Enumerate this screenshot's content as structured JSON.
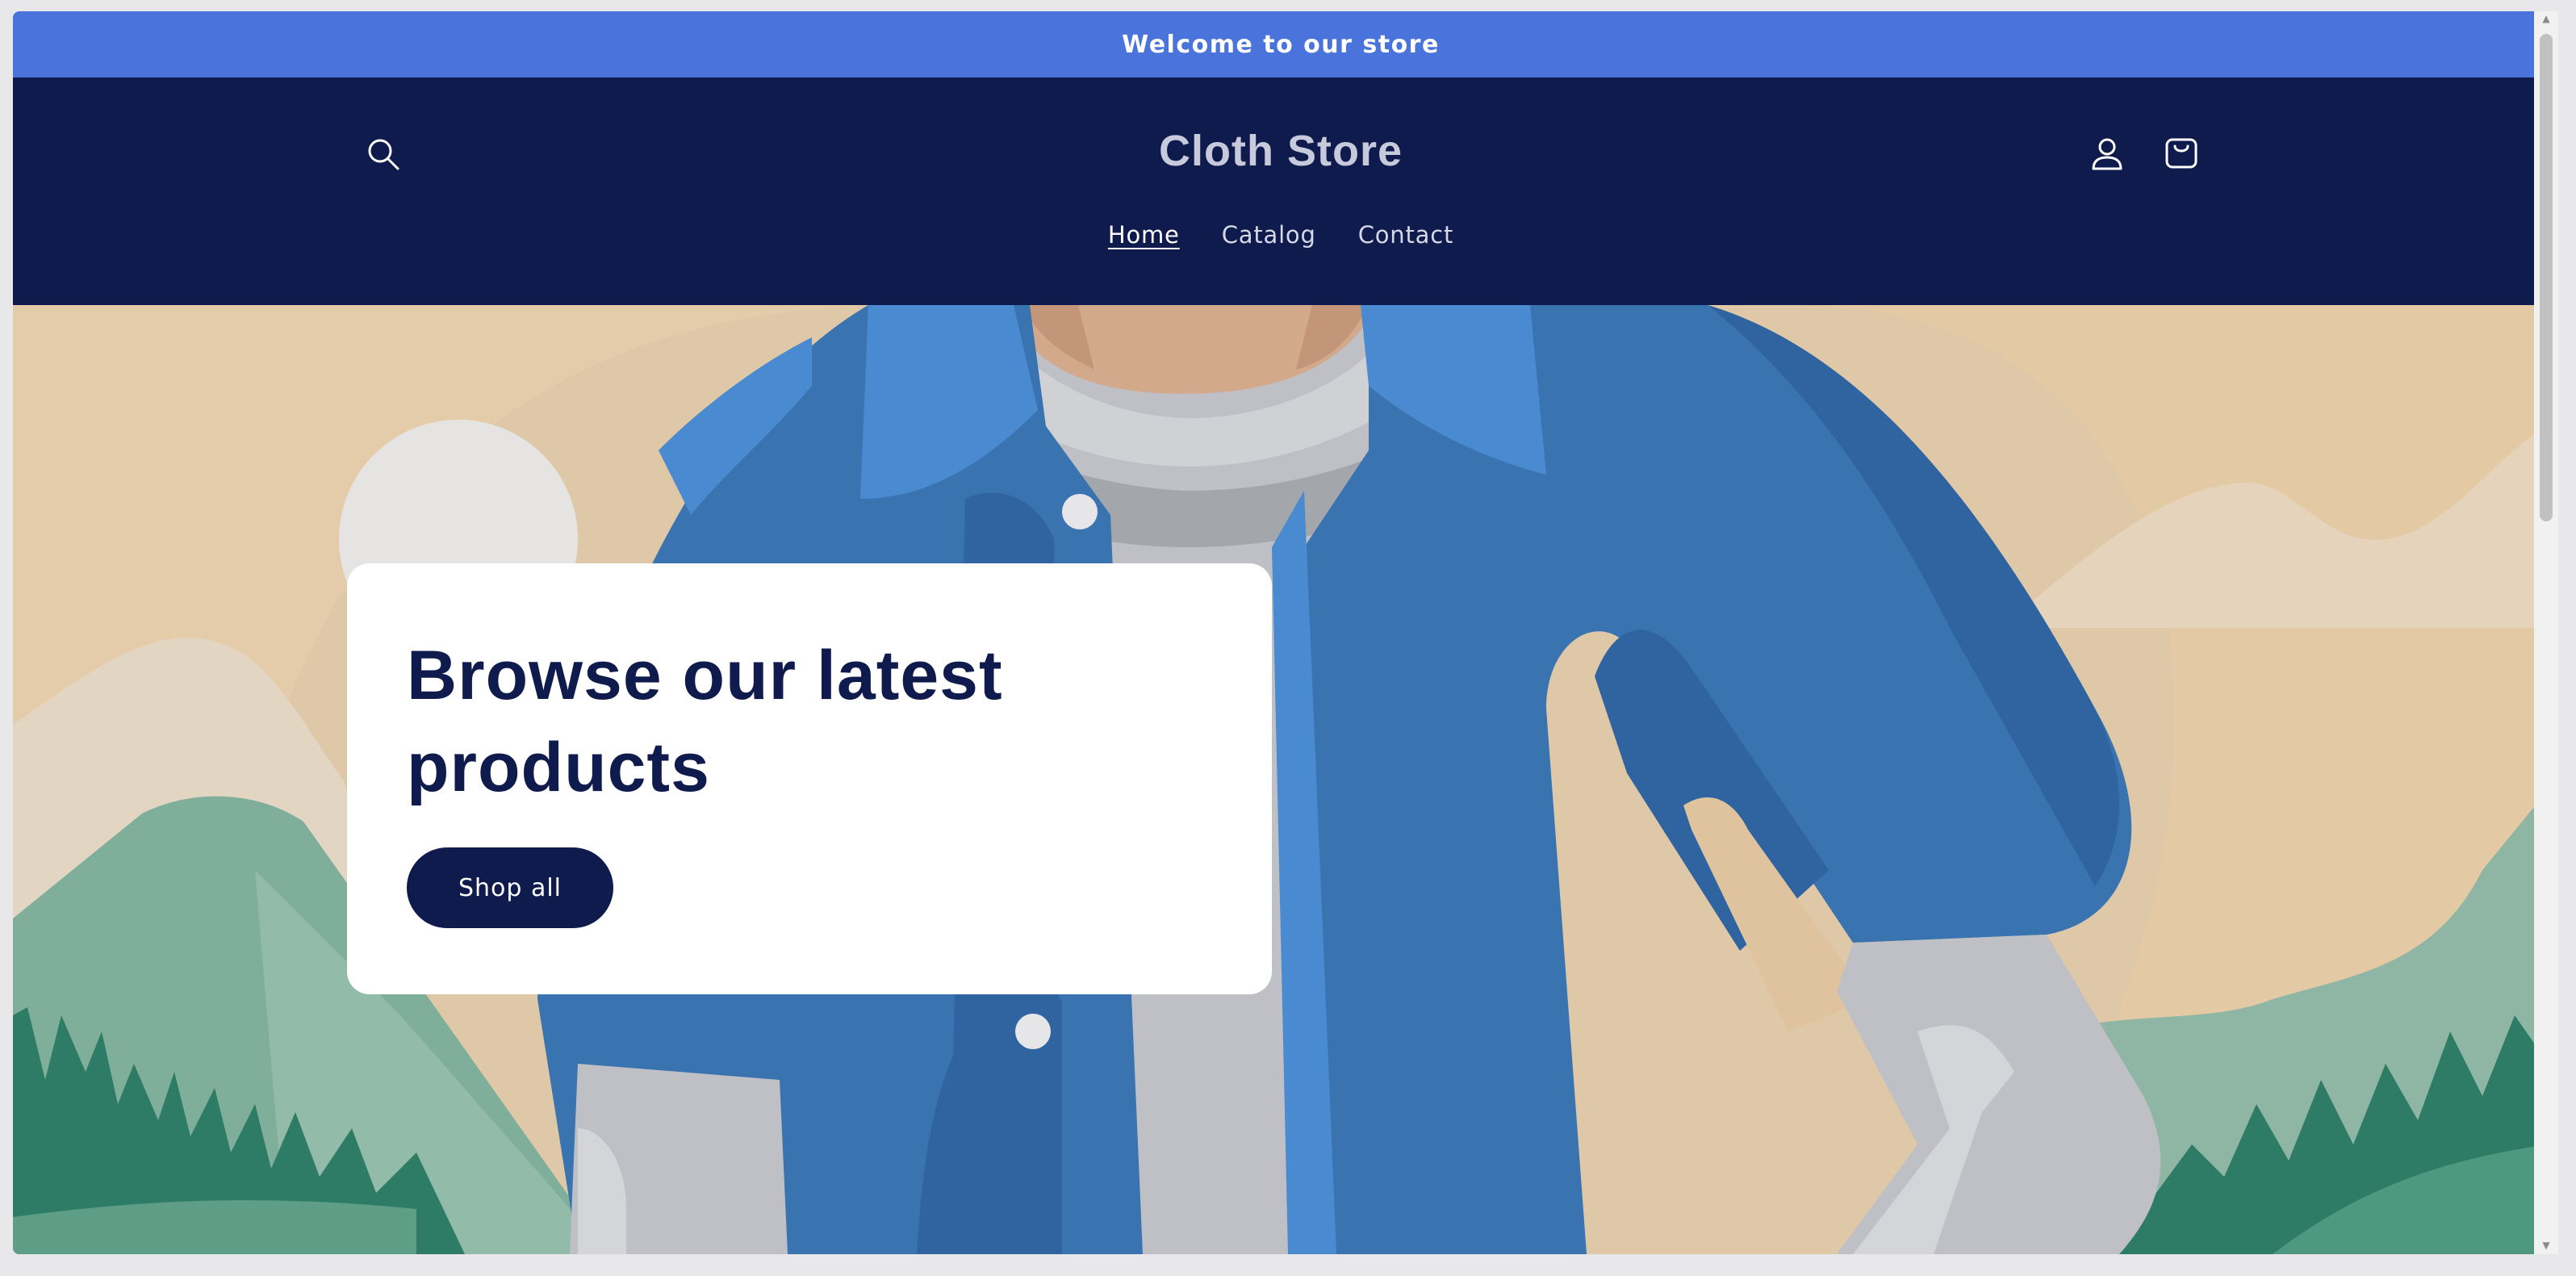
{
  "announcement": {
    "text": "Welcome to our store"
  },
  "header": {
    "store_name": "Cloth Store",
    "nav": [
      {
        "label": "Home",
        "active": true
      },
      {
        "label": "Catalog",
        "active": false
      },
      {
        "label": "Contact",
        "active": false
      }
    ],
    "icons": {
      "search": "search-icon",
      "account": "account-icon",
      "cart": "cart-icon"
    }
  },
  "hero": {
    "heading": "Browse our latest products",
    "cta_label": "Shop all"
  },
  "colors": {
    "announcement_bg": "#4a73dc",
    "header_bg": "#0f1a4d",
    "accent": "#0f1a4d",
    "hero_sand": "#dfc8a7"
  }
}
